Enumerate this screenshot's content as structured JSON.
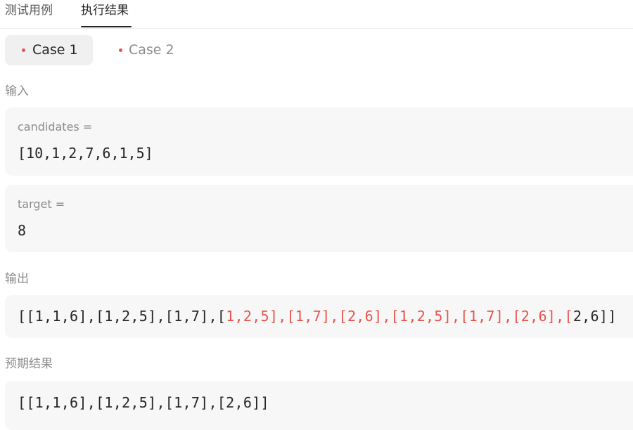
{
  "tabs": [
    {
      "label": "测试用例",
      "active": false
    },
    {
      "label": "执行结果",
      "active": true
    }
  ],
  "cases": [
    {
      "label": "Case 1",
      "selected": true
    },
    {
      "label": "Case 2",
      "selected": false
    }
  ],
  "input": {
    "label": "输入",
    "params": [
      {
        "name": "candidates =",
        "value": "[10,1,2,7,6,1,5]"
      },
      {
        "name": "target =",
        "value": "8"
      }
    ]
  },
  "output": {
    "label": "输出",
    "segments": [
      {
        "text": "[[1,1,6],[1,2,5],[1,7],[",
        "diff": false
      },
      {
        "text": "1,2,5],[1,7],[2,6],[1,2,5],[1,7],[2,6],[",
        "diff": true
      },
      {
        "text": "2,6]]",
        "diff": false
      }
    ]
  },
  "expected": {
    "label": "预期结果",
    "value": "[[1,1,6],[1,2,5],[1,7],[2,6]]"
  },
  "colors": {
    "diff_red": "#e5534b",
    "case_dot": "#e5534b",
    "panel_bg": "#f7f7f7",
    "selected_case_bg": "#f0f0f0",
    "active_tab_underline": "#262626"
  }
}
